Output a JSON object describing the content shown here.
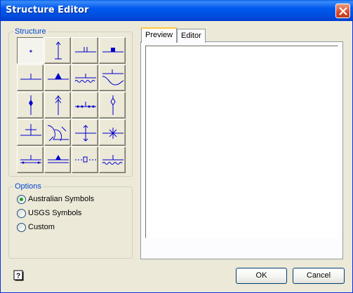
{
  "window": {
    "title": "Structure Editor"
  },
  "structure_group": {
    "label": "Structure",
    "symbols": [
      {
        "icon": "point-symbol-icon"
      },
      {
        "icon": "vertical-arrow-symbol-icon"
      },
      {
        "icon": "double-tick-line-symbol-icon"
      },
      {
        "icon": "filled-square-line-symbol-icon"
      },
      {
        "icon": "single-tick-line-symbol-icon"
      },
      {
        "icon": "filled-triangle-line-symbol-icon"
      },
      {
        "icon": "tick-wavy-line-symbol-icon"
      },
      {
        "icon": "s-curve-line-symbol-icon"
      },
      {
        "icon": "diamond-down-arrow-symbol-icon"
      },
      {
        "icon": "double-chevron-arrow-symbol-icon"
      },
      {
        "icon": "dotted-tick-line-symbol-icon"
      },
      {
        "icon": "hollow-diamond-arrow-symbol-icon"
      },
      {
        "icon": "cross-line-symbol-icon"
      },
      {
        "icon": "fold-line-symbol-icon"
      },
      {
        "icon": "double-arrow-line-symbol-icon"
      },
      {
        "icon": "star-cross-symbol-icon"
      },
      {
        "icon": "dotted-tick-double-line-symbol-icon"
      },
      {
        "icon": "triangle-double-line-symbol-icon"
      },
      {
        "icon": "dashed-box-line-symbol-icon"
      },
      {
        "icon": "wavy-tick-double-line-symbol-icon"
      }
    ],
    "selected_index": 0
  },
  "options_group": {
    "label": "Options",
    "options": [
      {
        "label": "Australian Symbols",
        "checked": true
      },
      {
        "label": "USGS Symbols",
        "checked": false
      },
      {
        "label": "Custom",
        "checked": false
      }
    ]
  },
  "tabs": [
    {
      "label": "Preview",
      "active": true
    },
    {
      "label": "Editor",
      "active": false
    }
  ],
  "buttons": {
    "ok": "OK",
    "cancel": "Cancel"
  },
  "colors": {
    "symbol": "#0000cc",
    "titlebar": "#0058ee"
  }
}
